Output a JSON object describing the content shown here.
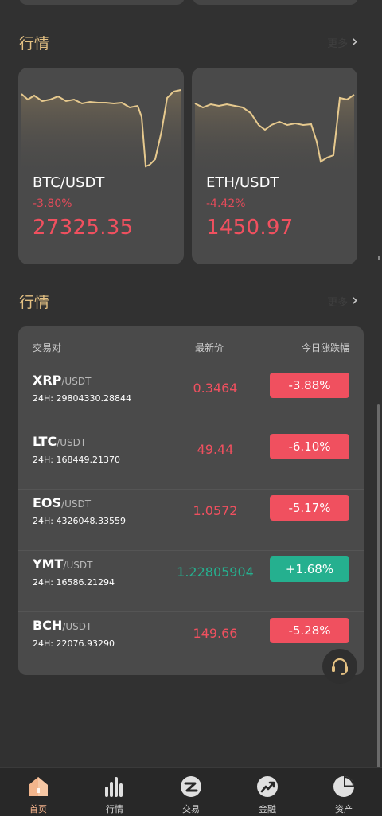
{
  "sections": {
    "top_title": "行情",
    "top_more": "更多",
    "list_title": "行情",
    "list_more": "更多"
  },
  "cards": [
    {
      "pair": "BTC/USDT",
      "change": "-3.80%",
      "price": "27325.35"
    },
    {
      "pair": "ETH/USDT",
      "change": "-4.42%",
      "price": "1450.97"
    }
  ],
  "table": {
    "headers": {
      "pair": "交易对",
      "price": "最新价",
      "change": "今日涨跌幅"
    },
    "rows": [
      {
        "base": "XRP",
        "quote": "/USDT",
        "volume": "24H: 29804330.28844",
        "price": "0.3464",
        "change": "-3.88%",
        "direction": "down"
      },
      {
        "base": "LTC",
        "quote": "/USDT",
        "volume": "24H: 168449.21370",
        "price": "49.44",
        "change": "-6.10%",
        "direction": "down"
      },
      {
        "base": "EOS",
        "quote": "/USDT",
        "volume": "24H: 4326048.33559",
        "price": "1.0572",
        "change": "-5.17%",
        "direction": "down"
      },
      {
        "base": "YMT",
        "quote": "/USDT",
        "volume": "24H: 16586.21294",
        "price": "1.22805904",
        "change": "+1.68%",
        "direction": "up"
      },
      {
        "base": "BCH",
        "quote": "/USDT",
        "volume": "24H: 22076.93290",
        "price": "149.66",
        "change": "-5.28%",
        "direction": "down"
      }
    ]
  },
  "tabs": [
    {
      "label": "首页",
      "icon": "home-icon",
      "active": true
    },
    {
      "label": "行情",
      "icon": "market-bars-icon",
      "active": false
    },
    {
      "label": "交易",
      "icon": "trade-icon",
      "active": false
    },
    {
      "label": "金融",
      "icon": "finance-trend-icon",
      "active": false
    },
    {
      "label": "资产",
      "icon": "assets-pie-icon",
      "active": false
    }
  ],
  "colors": {
    "accent_gold": "#e4c183",
    "down_red": "#f0505f",
    "up_green": "#25b08f",
    "card_bg": "#4a4a4a",
    "page_bg": "#313131"
  }
}
